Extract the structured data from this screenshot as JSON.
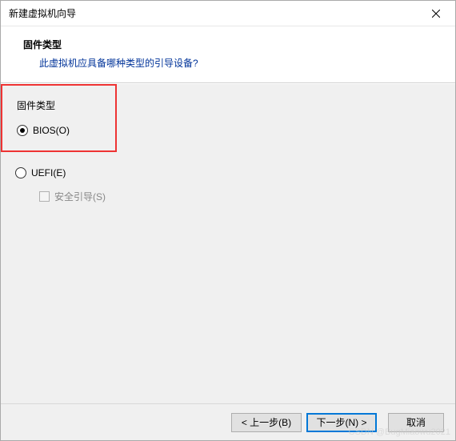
{
  "titlebar": {
    "title": "新建虚拟机向导"
  },
  "header": {
    "title": "固件类型",
    "description": "此虚拟机应具备哪种类型的引导设备?"
  },
  "group": {
    "label": "固件类型",
    "options": {
      "bios": {
        "label": "BIOS(O)",
        "checked": true
      },
      "uefi": {
        "label": "UEFI(E)",
        "checked": false
      },
      "secure_boot": {
        "label": "安全引导(S)",
        "checked": false,
        "enabled": false
      }
    }
  },
  "footer": {
    "back": "< 上一步(B)",
    "next": "下一步(N) >",
    "cancel": "取消"
  },
  "watermark": "CSDN @BugMiaowu2021"
}
